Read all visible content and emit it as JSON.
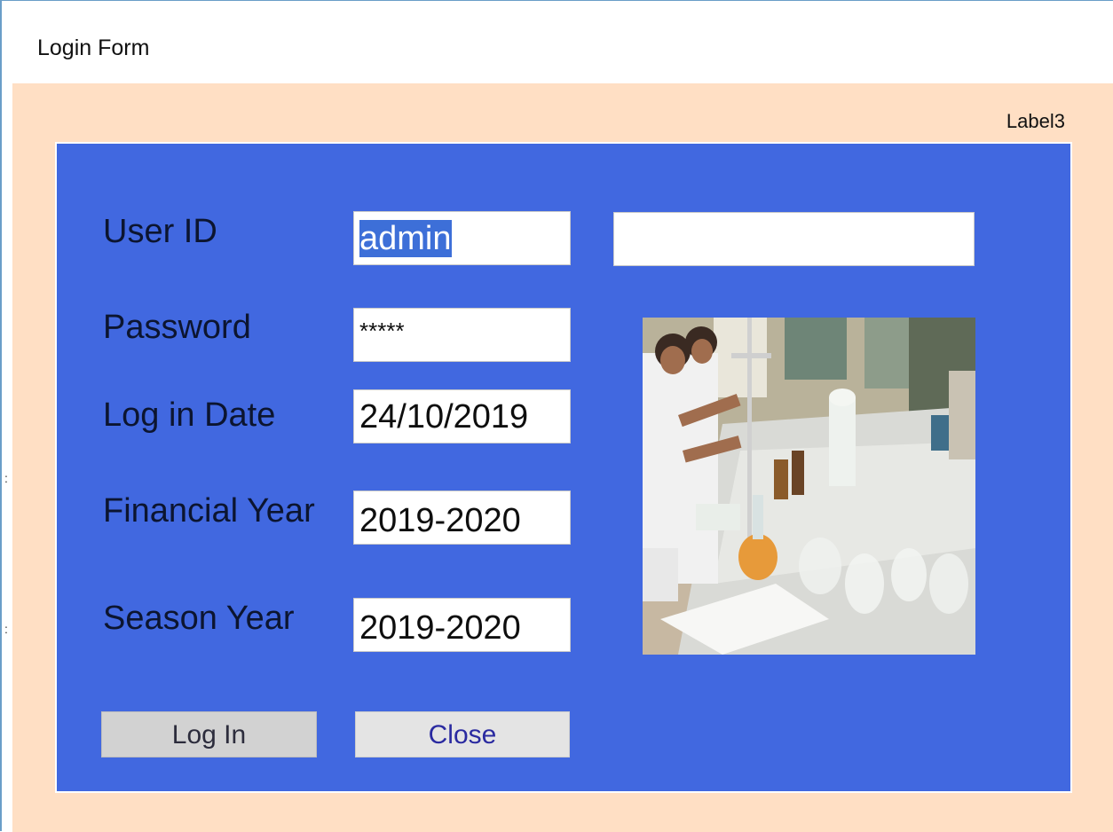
{
  "window": {
    "title": "Login Form"
  },
  "form": {
    "corner_label": "Label3",
    "user_id": {
      "label": "User ID",
      "value": "admin"
    },
    "password": {
      "label": "Password",
      "value": "*****"
    },
    "login_date": {
      "label": "Log in Date",
      "value": "24/10/2019"
    },
    "financial_year": {
      "label": "Financial Year",
      "value": "2019-2020"
    },
    "season_year": {
      "label": "Season Year",
      "value": "2019-2020"
    },
    "extra_field": {
      "value": ""
    },
    "photo": {
      "icon": "laboratory-photo"
    },
    "buttons": {
      "login": "Log In",
      "close": "Close"
    }
  },
  "colors": {
    "panel": "#4168e0",
    "background": "#ffdfc4",
    "selection": "#3d6fd8",
    "close_text": "#2a2aa0"
  }
}
